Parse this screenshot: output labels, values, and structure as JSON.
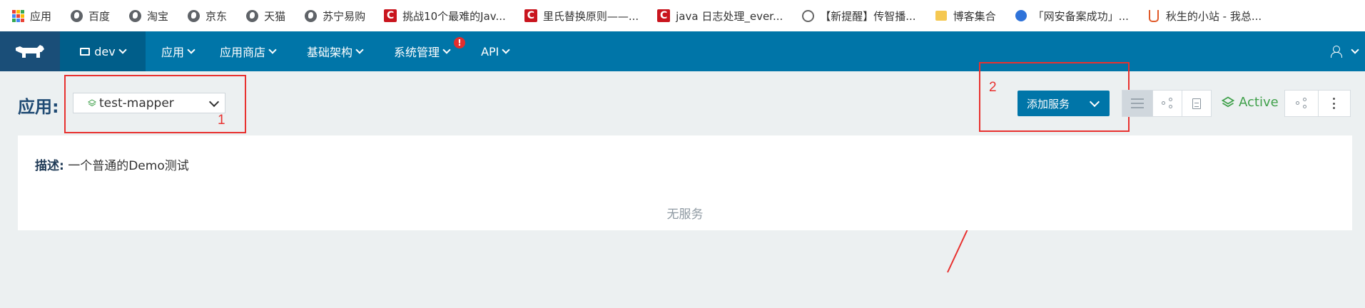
{
  "bookmarks": [
    {
      "label": "应用",
      "icon": "apps-grid-icon"
    },
    {
      "label": "百度",
      "icon": "globe-icon"
    },
    {
      "label": "淘宝",
      "icon": "globe-icon"
    },
    {
      "label": "京东",
      "icon": "globe-icon"
    },
    {
      "label": "天猫",
      "icon": "globe-icon"
    },
    {
      "label": "苏宁易购",
      "icon": "globe-icon"
    },
    {
      "label": "挑战10个最难的Jav...",
      "icon": "csdn-icon"
    },
    {
      "label": "里氏替换原则——...",
      "icon": "csdn-icon"
    },
    {
      "label": "java 日志处理_ever...",
      "icon": "csdn-icon"
    },
    {
      "label": "【新提醒】传智播...",
      "icon": "circle-icon"
    },
    {
      "label": "博客集合",
      "icon": "folder-icon"
    },
    {
      "label": "「网安备案成功」...",
      "icon": "baidu-paw-icon"
    },
    {
      "label": "秋生的小站 - 我总...",
      "icon": "java-cup-icon"
    }
  ],
  "topnav": {
    "env_label": "dev",
    "items": [
      {
        "label": "应用"
      },
      {
        "label": "应用商店"
      },
      {
        "label": "基础架构"
      },
      {
        "label": "系统管理",
        "alert": "!"
      },
      {
        "label": "API"
      }
    ]
  },
  "header": {
    "app_label": "应用:",
    "app_select_value": "test-mapper",
    "add_service_label": "添加服务",
    "status": "Active"
  },
  "annotations": [
    {
      "num": "1"
    },
    {
      "num": "2"
    }
  ],
  "panel": {
    "desc_label": "描述:",
    "desc_value": "一个普通的Demo测试",
    "empty_text": "无服务"
  },
  "colors": {
    "nav_bg": "#0075a8",
    "nav_env_bg": "#005e8a",
    "logo_bg": "#1a4e78",
    "page_bg": "#ecf0f1",
    "status_green": "#3fa04a",
    "annotation_red": "#e8312f"
  }
}
